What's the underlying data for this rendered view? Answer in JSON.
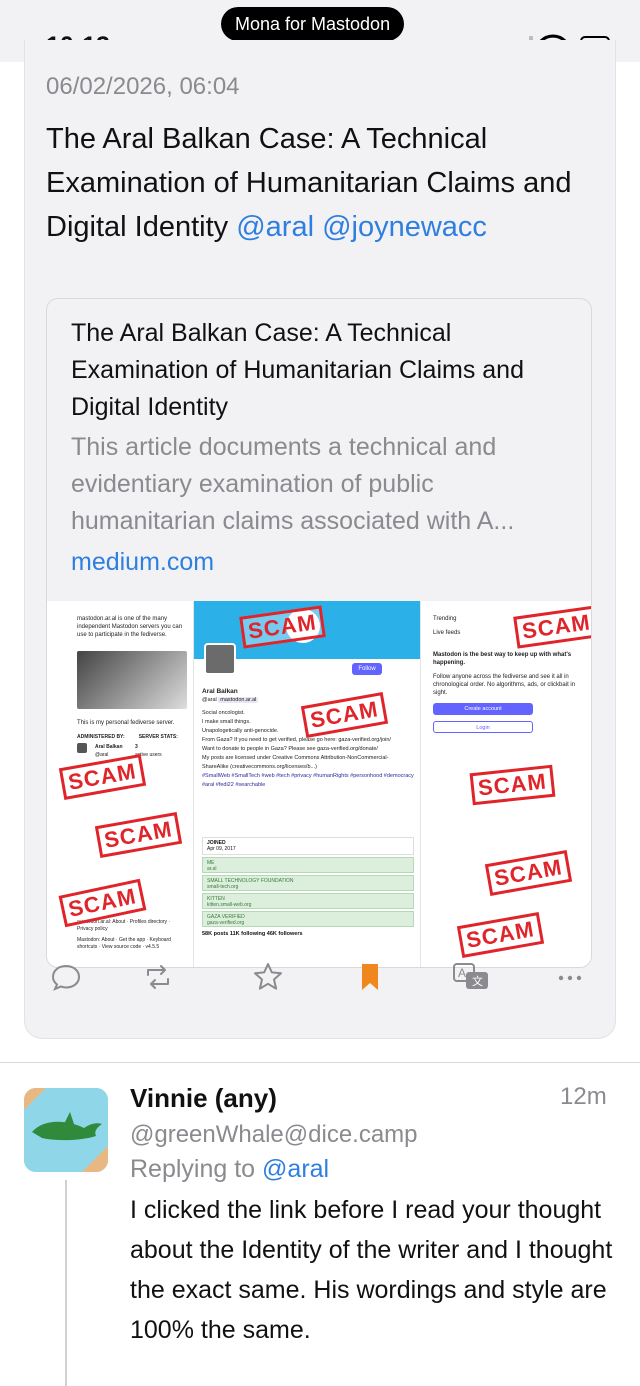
{
  "status_bar": {
    "app_pill": "Mona for Mastodon",
    "time": "10:13"
  },
  "post": {
    "date": "06/02/2026, 06:04",
    "text": "The Aral Balkan Case: A Technical Examination of Humanitarian Claims and Digital Identity",
    "mentions": [
      "@aral",
      "@joynewacc"
    ],
    "link_card": {
      "title": "The Aral Balkan Case: A Technical Examination of Humanitarian Claims and Digital Identity",
      "description": "This article documents a technical and evidentiary examination of public humanitarian claims associated with A...",
      "domain": "medium.com",
      "preview": {
        "stamp_text": "SCAM",
        "left": {
          "intro": "mastodon.ar.al is one of the many independent Mastodon servers you can use to participate in the fediverse.",
          "about": "This is my personal fediverse server.",
          "administered_by": "ADMINISTERED BY:",
          "server_stats": "SERVER STATS:",
          "admin_name": "Aral Balkan",
          "admin_handle": "@aral",
          "active_users_count": "3",
          "active_users_label": "active users",
          "footer1": "mastodon.ar.al: About · Profiles directory · Privacy policy",
          "footer2": "Mastodon: About · Get the app · Keyboard shortcuts · View source code · v4.5.5"
        },
        "middle": {
          "follow": "Follow",
          "name": "Aral Balkan",
          "handle": "@aral",
          "handle_badge": "mastodon.ar.al",
          "bio": [
            "Social oncologist.",
            "I make small things.",
            "Unapologetically anti-genocide.",
            "From Gaza? If you need to get verified, please go here: gaza-verified.org/join/",
            "Want to donate to people in Gaza? Please see gaza-verified.org/donate/",
            "My posts are licensed under Creative Commons Attribution-NonCommercial-ShareAlike (creativecommons.org/licenses/b...)",
            "#SmallWeb #SmallTech #web #tech #privacy #humanRights #personhood #democracy #aral #fedi22 #searchable"
          ],
          "joined_label": "JOINED",
          "joined_date": "Apr 09, 2017",
          "links": [
            {
              "label": "ME",
              "value": "ar.al"
            },
            {
              "label": "SMALL TECHNOLOGY FOUNDATION",
              "value": "small-tech.org"
            },
            {
              "label": "KITTEN",
              "value": "kitten.small-web.org"
            },
            {
              "label": "GAZA VERIFIED",
              "value": "gaza-verified.org"
            }
          ],
          "stats": "58K posts    11K following    46K followers"
        },
        "right": {
          "trending": "Trending",
          "live_feeds": "Live feeds",
          "headline": "Mastodon is the best way to keep up with what's happening.",
          "body": "Follow anyone across the fediverse and see it all in chronological order. No algorithms, ads, or clickbait in sight.",
          "create_account": "Create account",
          "login": "Login"
        }
      }
    }
  },
  "actions": [
    "reply-icon",
    "boost-icon",
    "favourite-icon",
    "bookmark-icon",
    "translate-icon",
    "more-icon"
  ],
  "colors": {
    "accent": "#2f7fe0",
    "bookmark": "#f0861e",
    "stamp": "#e0242a",
    "mastodon_purple": "#6364ff"
  },
  "reply": {
    "name": "Vinnie (any)",
    "time": "12m",
    "handle": "@greenWhale@dice.camp",
    "replying_prefix": "Replying to ",
    "replying_to": "@aral",
    "text": "I clicked the link before I read your thought about the Identity of the writer and I thought the exact same. His wordings and style are 100% the same."
  }
}
